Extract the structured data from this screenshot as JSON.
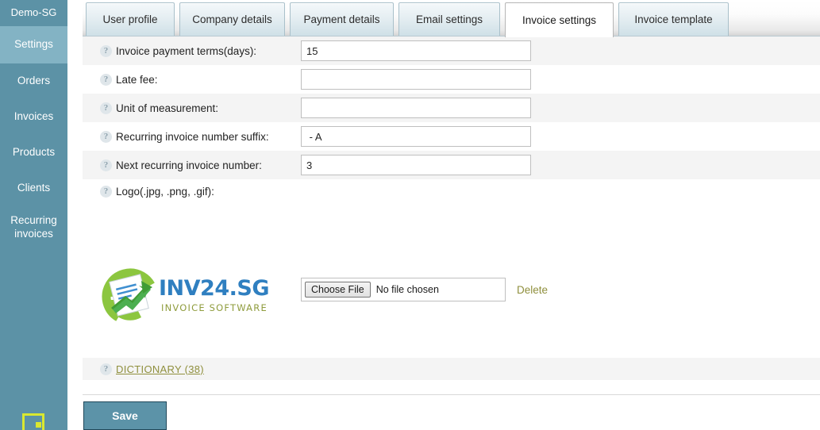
{
  "sidebar": {
    "brand": "Demo-SG",
    "items": [
      {
        "label": "Settings",
        "active": true
      },
      {
        "label": "Orders",
        "active": false
      },
      {
        "label": "Invoices",
        "active": false
      },
      {
        "label": "Products",
        "active": false
      },
      {
        "label": "Clients",
        "active": false
      },
      {
        "label": "Recurring invoices",
        "active": false
      }
    ],
    "bottom_icon": "screen-icon",
    "background_color": "#5c92a6",
    "active_color": "#83b3c4"
  },
  "tabs": [
    {
      "label": "User profile",
      "active": false
    },
    {
      "label": "Company details",
      "active": false
    },
    {
      "label": "Payment details",
      "active": false
    },
    {
      "label": "Email settings",
      "active": false
    },
    {
      "label": "Invoice settings",
      "active": true
    },
    {
      "label": "Invoice template",
      "active": false
    }
  ],
  "form": {
    "help_icon_glyph": "?",
    "fields": [
      {
        "label": "Invoice payment terms(days):",
        "value": "15",
        "placeholder": ""
      },
      {
        "label": "Late fee:",
        "value": "",
        "placeholder": ""
      },
      {
        "label": "Unit of measurement:",
        "value": "",
        "placeholder": ""
      },
      {
        "label": "Recurring invoice number suffix:",
        "value": " - A",
        "placeholder": ""
      },
      {
        "label": "Next recurring invoice number:",
        "value": "3",
        "placeholder": ""
      }
    ],
    "logo_field_label": "Logo(.jpg, .png, .gif):"
  },
  "logo": {
    "brand_text": "INV24.SG",
    "tagline": "INVOICE SOFTWARE",
    "brand_color": "#2f7fc0",
    "tagline_color": "#8f9c3d",
    "mark_green": "#8cc63f",
    "mark_dark_green": "#3f9c35"
  },
  "upload": {
    "choose_file_label": "Choose File",
    "no_file_text": "No file chosen",
    "delete_label": "Delete"
  },
  "dictionary": {
    "label": "DICTIONARY (38)"
  },
  "actions": {
    "save_label": "Save",
    "save_color": "#5c93a8"
  }
}
